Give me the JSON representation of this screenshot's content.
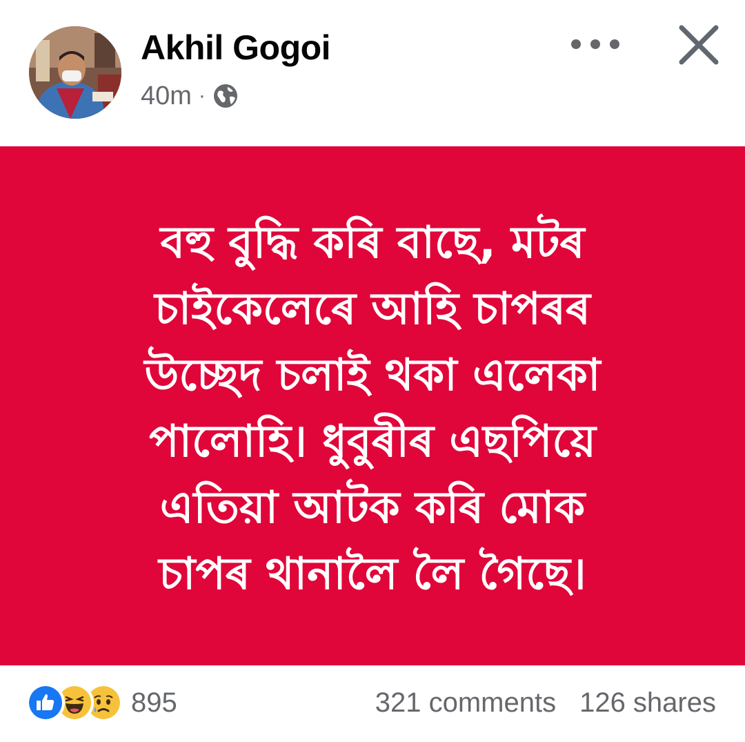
{
  "header": {
    "author_name": "Akhil Gogoi",
    "timestamp": "40m",
    "separator": "·",
    "privacy_icon": "globe-icon",
    "more_icon": "more-options-icon",
    "close_icon": "close-icon"
  },
  "post": {
    "background_color": "#e0063a",
    "text_color": "#ffffff",
    "lines": [
      "বহু বুদ্ধি কৰি বাছে, মটৰ",
      "চাইকেলেৰে আহি চাপৰৰ",
      "উচ্ছেদ চলাই থকা এলেকা",
      "পালোহি। ধুবুৰীৰ এছপিয়ে",
      "এতিয়া আটক কৰি মোক",
      "চাপৰ থানালৈ লৈ গৈছে।"
    ]
  },
  "footer": {
    "reaction_icons": [
      "like-icon",
      "haha-icon",
      "sad-icon"
    ],
    "reaction_count": "895",
    "comments": "321 comments",
    "shares": "126 shares"
  }
}
